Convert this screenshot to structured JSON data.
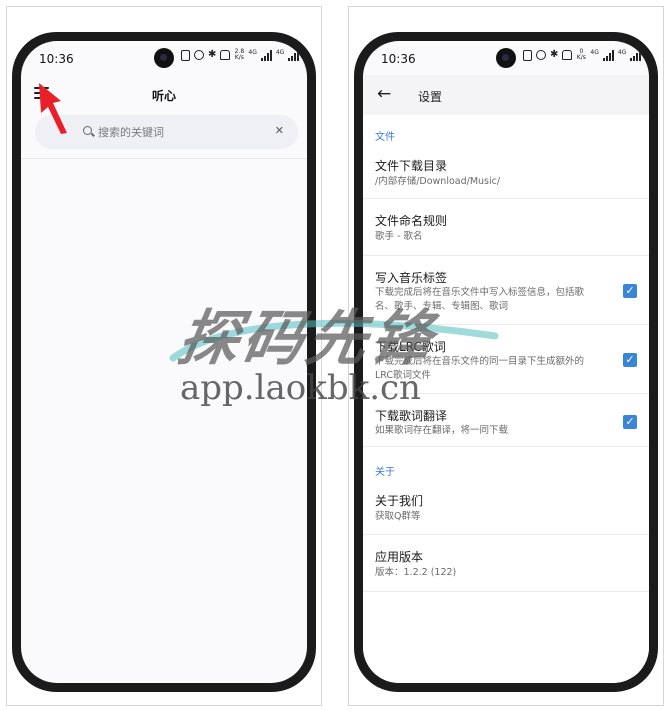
{
  "status_bar": {
    "time": "10:36",
    "speed_left": "2.8\nK/s",
    "speed_right": "0\nK/s",
    "network": "4G",
    "battery": "49"
  },
  "search_screen": {
    "title": "听心",
    "search_placeholder": "搜索的关键词",
    "clear_glyph": "✕",
    "icons": [
      "menu-icon",
      "search-icon",
      "close-icon"
    ]
  },
  "settings_screen": {
    "title": "设置",
    "back_glyph": "←",
    "sections": [
      {
        "label": "文件",
        "items": [
          {
            "title": "文件下载目录",
            "subtitle": "/内部存储/Download/Music/"
          },
          {
            "title": "文件命名规则",
            "subtitle": "歌手 - 歌名"
          },
          {
            "title": "写入音乐标签",
            "subtitle": "下载完成后将在音乐文件中写入标签信息，包括歌名、歌手、专辑、专辑图、歌词",
            "checked": true
          },
          {
            "title": "下载LRC歌词",
            "subtitle": "下载完成后将在音乐文件的同一目录下生成额外的LRC歌词文件",
            "checked": true
          },
          {
            "title": "下载歌词翻译",
            "subtitle": "如果歌词存在翻译，将一同下载",
            "checked": true
          }
        ]
      },
      {
        "label": "关于",
        "items": [
          {
            "title": "关于我们",
            "subtitle": "获取Q群等"
          },
          {
            "title": "应用版本",
            "subtitle": "版本：1.2.2 (122)"
          }
        ]
      }
    ],
    "check_glyph": "✓"
  },
  "watermark": {
    "main": "探码先锋",
    "url": "app.laokbk.cn"
  },
  "colors": {
    "accent": "#3a86d6",
    "section_label": "#3a7bd5",
    "annotation_arrow": "#e8202a",
    "phone_frame": "#1b1b1b"
  }
}
